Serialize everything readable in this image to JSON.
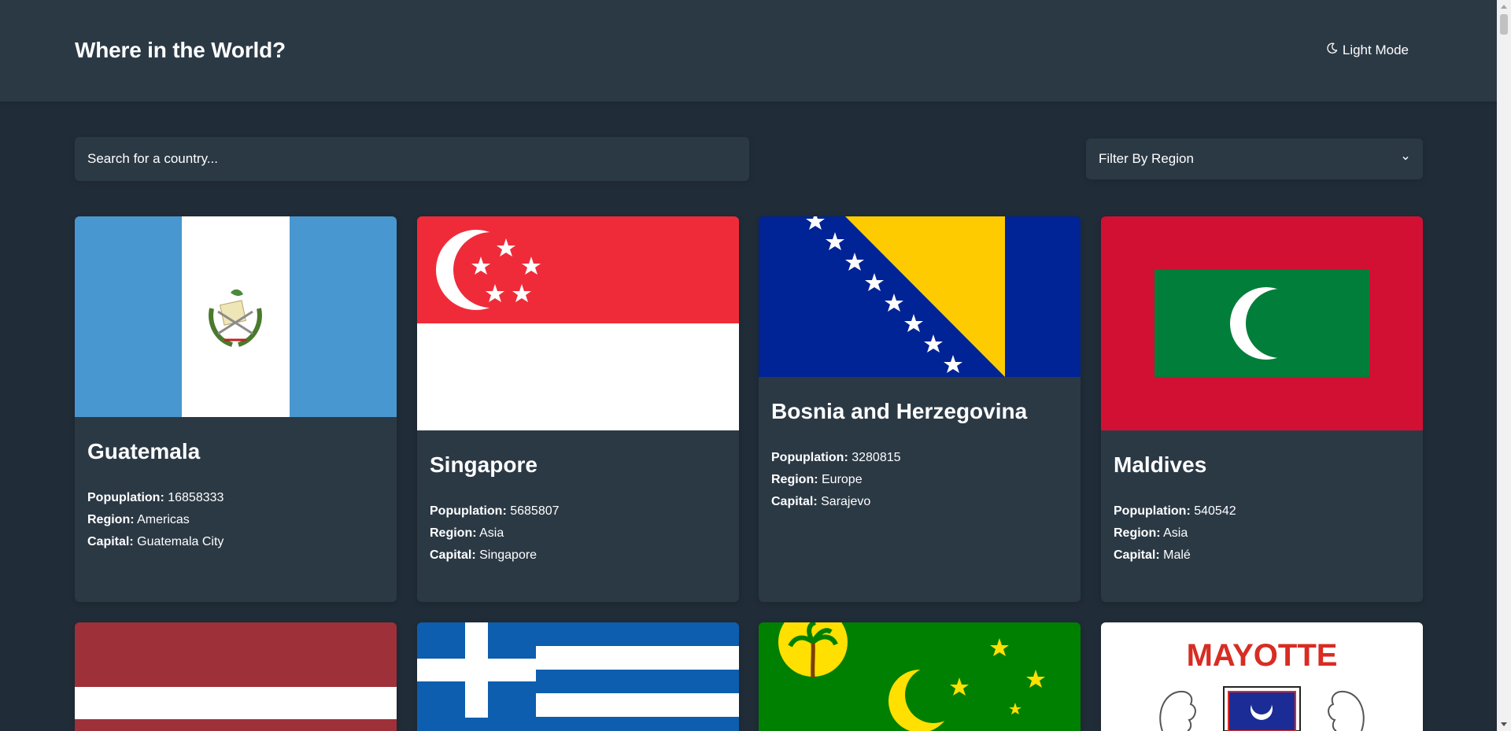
{
  "header": {
    "title": "Where in the World?",
    "mode_label": "Light Mode",
    "mode_icon": "moon-icon"
  },
  "search": {
    "placeholder": "Search for a country..."
  },
  "filter": {
    "label": "Filter By Region",
    "icon": "chevron-down-icon"
  },
  "field_labels": {
    "population": "Popuplation",
    "region": "Region",
    "capital": "Capital"
  },
  "countries": [
    {
      "name": "Guatemala",
      "population": "16858333",
      "region": "Americas",
      "capital": "Guatemala City"
    },
    {
      "name": "Singapore",
      "population": "5685807",
      "region": "Asia",
      "capital": "Singapore"
    },
    {
      "name": "Bosnia and Herzegovina",
      "population": "3280815",
      "region": "Europe",
      "capital": "Sarajevo"
    },
    {
      "name": "Maldives",
      "population": "540542",
      "region": "Asia",
      "capital": "Malé"
    }
  ],
  "flag_text": {
    "mayotte": "MAYOTTE"
  },
  "colors": {
    "background": "#202c37",
    "surface": "#2b3945",
    "text": "#ffffff"
  }
}
